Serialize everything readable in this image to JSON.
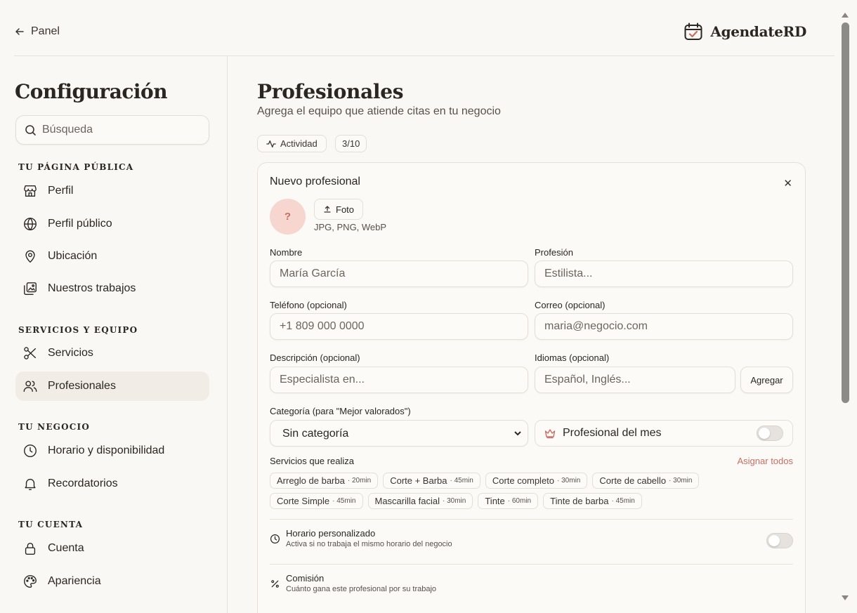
{
  "topbar": {
    "back_label": "Panel",
    "brand_name": "AgendateRD"
  },
  "sidebar": {
    "title": "Configuración",
    "search_placeholder": "Búsqueda",
    "sections": [
      {
        "title": "Tu página pública",
        "items": [
          {
            "label": "Perfil",
            "icon": "store-icon"
          },
          {
            "label": "Perfil público",
            "icon": "globe-icon"
          },
          {
            "label": "Ubicación",
            "icon": "map-pin-icon"
          },
          {
            "label": "Nuestros trabajos",
            "icon": "gallery-icon"
          }
        ]
      },
      {
        "title": "Servicios y equipo",
        "items": [
          {
            "label": "Servicios",
            "icon": "scissors-icon"
          },
          {
            "label": "Profesionales",
            "icon": "users-icon",
            "active": true
          }
        ]
      },
      {
        "title": "Tu negocio",
        "items": [
          {
            "label": "Horario y disponibilidad",
            "icon": "clock-icon"
          },
          {
            "label": "Recordatorios",
            "icon": "bell-icon"
          }
        ]
      },
      {
        "title": "Tu cuenta",
        "items": [
          {
            "label": "Cuenta",
            "icon": "lock-icon"
          },
          {
            "label": "Apariencia",
            "icon": "palette-icon"
          }
        ]
      }
    ]
  },
  "main": {
    "title": "Profesionales",
    "subtitle": "Agrega el equipo que atiende citas en tu negocio",
    "activity_label": "Actividad",
    "count_badge": "3/10",
    "form": {
      "title": "Nuevo profesional",
      "close_glyph": "✕",
      "avatar_placeholder": "?",
      "photo_button": "Foto",
      "photo_hint": "JPG, PNG, WebP",
      "name_label": "Nombre",
      "name_placeholder": "María García",
      "profession_label": "Profesión",
      "profession_placeholder": "Estilista...",
      "phone_label": "Teléfono (opcional)",
      "phone_placeholder": "+1 809 000 0000",
      "email_label": "Correo (opcional)",
      "email_placeholder": "maria@negocio.com",
      "description_label": "Descripción (opcional)",
      "description_placeholder": "Especialista en...",
      "languages_label": "Idiomas (opcional)",
      "languages_placeholder": "Español, Inglés...",
      "add_button": "Agregar",
      "category_label": "Categoría (para \"Mejor valorados\")",
      "category_selected": "Sin categoría",
      "professional_of_month": "Profesional del mes",
      "professional_of_month_on": false,
      "services_label": "Servicios que realiza",
      "assign_all": "Asignar todos",
      "services": [
        {
          "name": "Arreglo de barba",
          "duration": "· 20min"
        },
        {
          "name": "Corte + Barba",
          "duration": "· 45min"
        },
        {
          "name": "Corte completo",
          "duration": "· 30min"
        },
        {
          "name": "Corte de cabello",
          "duration": "· 30min"
        },
        {
          "name": "Corte Simple",
          "duration": "· 45min"
        },
        {
          "name": "Mascarilla facial",
          "duration": "· 30min"
        },
        {
          "name": "Tinte",
          "duration": "· 60min"
        },
        {
          "name": "Tinte de barba",
          "duration": "· 45min"
        }
      ],
      "custom_schedule_title": "Horario personalizado",
      "custom_schedule_desc": "Activa si no trabaja el mismo horario del negocio",
      "custom_schedule_on": false,
      "commission_title": "Comisión",
      "commission_desc": "Cuánto gana este profesional por su trabajo"
    }
  },
  "colors": {
    "background": "#faf8f4",
    "accent": "#c86e62",
    "active_nav": "#f1ede6",
    "border": "#e4dfd6"
  }
}
